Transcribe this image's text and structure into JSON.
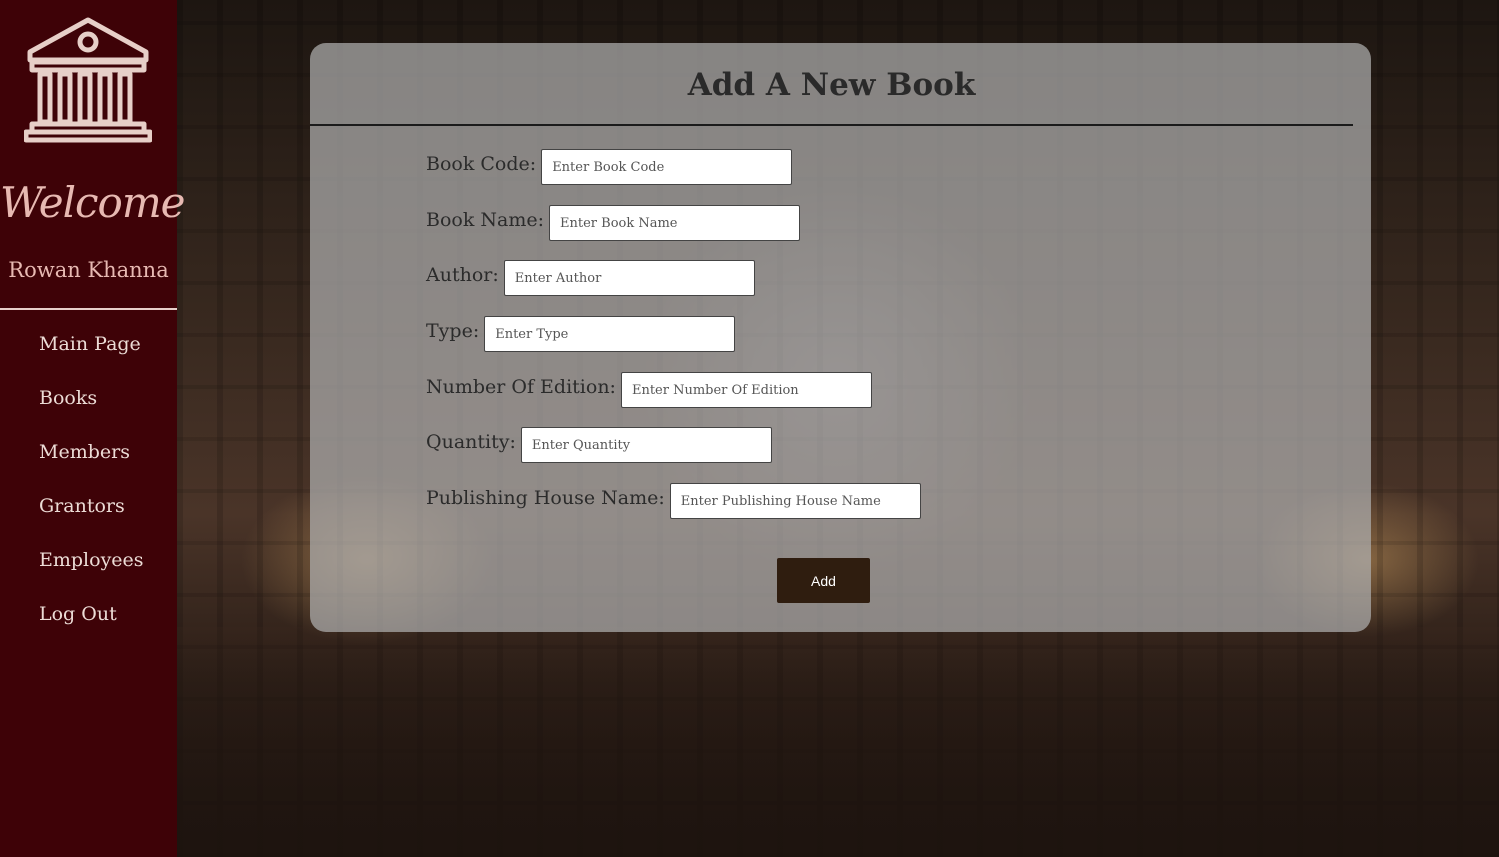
{
  "sidebar": {
    "logo_icon": "library-building-icon",
    "welcome_text": "Welcome",
    "user_name": "Rowan Khanna",
    "nav": [
      {
        "label": "Main Page"
      },
      {
        "label": "Books"
      },
      {
        "label": "Members"
      },
      {
        "label": "Grantors"
      },
      {
        "label": "Employees"
      },
      {
        "label": "Log Out"
      }
    ]
  },
  "form": {
    "title": "Add A New Book",
    "fields": [
      {
        "label": "Book Code:",
        "placeholder": "Enter Book Code",
        "value": ""
      },
      {
        "label": "Book Name:",
        "placeholder": "Enter Book Name",
        "value": ""
      },
      {
        "label": "Author:",
        "placeholder": "Enter Author",
        "value": ""
      },
      {
        "label": "Type:",
        "placeholder": "Enter Type",
        "value": ""
      },
      {
        "label": "Number Of Edition:",
        "placeholder": "Enter Number Of Edition",
        "value": ""
      },
      {
        "label": "Quantity:",
        "placeholder": "Enter Quantity",
        "value": ""
      },
      {
        "label": "Publishing House Name:",
        "placeholder": "Enter Publishing House Name",
        "value": ""
      }
    ],
    "submit_label": "Add"
  },
  "colors": {
    "sidebar_bg": "#3e0207",
    "sidebar_text": "#e7b9b2",
    "button_bg": "#2f1d0f",
    "panel_bg": "rgba(175,175,175,0.72)"
  }
}
